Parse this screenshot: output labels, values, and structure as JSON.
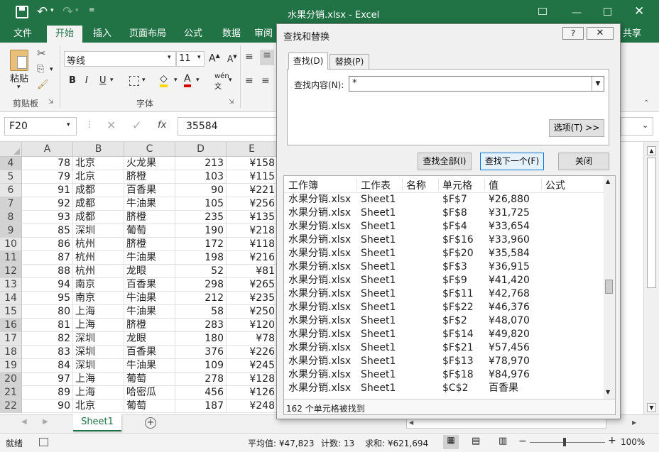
{
  "window": {
    "title": "水果分销.xlsx - Excel"
  },
  "ribbon_tabs": [
    "文件",
    "开始",
    "插入",
    "页面布局",
    "公式",
    "数据",
    "审阅"
  ],
  "ribbon": {
    "paste_label": "粘贴",
    "clipboard_group": "剪贴板",
    "font_group": "字体",
    "font_name": "等线",
    "font_size": "11",
    "share_label": "共享"
  },
  "formula_bar": {
    "name_box": "F20",
    "fx": "fx",
    "value": "35584"
  },
  "grid": {
    "columns": [
      "A",
      "B",
      "C",
      "D",
      "E"
    ],
    "rows": [
      {
        "n": "4",
        "a": "78",
        "b": "北京",
        "c": "火龙果",
        "d": "213",
        "e": "¥158"
      },
      {
        "n": "5",
        "a": "79",
        "b": "北京",
        "c": "脐橙",
        "d": "103",
        "e": "¥115"
      },
      {
        "n": "6",
        "a": "91",
        "b": "成都",
        "c": "百香果",
        "d": "90",
        "e": "¥221"
      },
      {
        "n": "7",
        "a": "92",
        "b": "成都",
        "c": "牛油果",
        "d": "105",
        "e": "¥256"
      },
      {
        "n": "8",
        "a": "93",
        "b": "成都",
        "c": "脐橙",
        "d": "235",
        "e": "¥135"
      },
      {
        "n": "9",
        "a": "85",
        "b": "深圳",
        "c": "葡萄",
        "d": "190",
        "e": "¥218"
      },
      {
        "n": "10",
        "a": "86",
        "b": "杭州",
        "c": "脐橙",
        "d": "172",
        "e": "¥118"
      },
      {
        "n": "11",
        "a": "87",
        "b": "杭州",
        "c": "牛油果",
        "d": "198",
        "e": "¥216"
      },
      {
        "n": "12",
        "a": "88",
        "b": "杭州",
        "c": "龙眼",
        "d": "52",
        "e": "¥81"
      },
      {
        "n": "13",
        "a": "94",
        "b": "南京",
        "c": "百香果",
        "d": "298",
        "e": "¥265"
      },
      {
        "n": "14",
        "a": "95",
        "b": "南京",
        "c": "牛油果",
        "d": "212",
        "e": "¥235"
      },
      {
        "n": "15",
        "a": "80",
        "b": "上海",
        "c": "牛油果",
        "d": "58",
        "e": "¥250"
      },
      {
        "n": "16",
        "a": "81",
        "b": "上海",
        "c": "脐橙",
        "d": "283",
        "e": "¥120"
      },
      {
        "n": "17",
        "a": "82",
        "b": "深圳",
        "c": "龙眼",
        "d": "180",
        "e": "¥78"
      },
      {
        "n": "18",
        "a": "83",
        "b": "深圳",
        "c": "百香果",
        "d": "376",
        "e": "¥226"
      },
      {
        "n": "19",
        "a": "84",
        "b": "深圳",
        "c": "牛油果",
        "d": "109",
        "e": "¥245"
      },
      {
        "n": "20",
        "a": "97",
        "b": "上海",
        "c": "葡萄",
        "d": "278",
        "e": "¥128"
      },
      {
        "n": "21",
        "a": "89",
        "b": "上海",
        "c": "哈密瓜",
        "d": "456",
        "e": "¥126"
      },
      {
        "n": "22",
        "a": "90",
        "b": "北京",
        "c": "葡萄",
        "d": "187",
        "e": "¥248"
      }
    ]
  },
  "sheet_tab": "Sheet1",
  "status": {
    "mode": "就绪",
    "average": "平均值: ¥47,823",
    "count": "计数: 13",
    "sum": "求和: ¥621,694",
    "zoom": "100%"
  },
  "dialog": {
    "title": "查找和替换",
    "help": "?",
    "tab_find": "查找(D)",
    "tab_replace": "替换(P)",
    "find_label": "查找内容(N):",
    "find_value": "*",
    "options_button": "选项(T) >>",
    "find_all_button": "查找全部(I)",
    "find_next_button": "查找下一个(F)",
    "close_button": "关闭",
    "result_headers": [
      "工作簿",
      "工作表",
      "名称",
      "单元格",
      "值",
      "公式"
    ],
    "results": [
      {
        "book": "水果分销.xlsx",
        "sheet": "Sheet1",
        "cell": "$F$7",
        "value": "¥26,880"
      },
      {
        "book": "水果分销.xlsx",
        "sheet": "Sheet1",
        "cell": "$F$8",
        "value": "¥31,725"
      },
      {
        "book": "水果分销.xlsx",
        "sheet": "Sheet1",
        "cell": "$F$4",
        "value": "¥33,654"
      },
      {
        "book": "水果分销.xlsx",
        "sheet": "Sheet1",
        "cell": "$F$16",
        "value": "¥33,960"
      },
      {
        "book": "水果分销.xlsx",
        "sheet": "Sheet1",
        "cell": "$F$20",
        "value": "¥35,584"
      },
      {
        "book": "水果分销.xlsx",
        "sheet": "Sheet1",
        "cell": "$F$3",
        "value": "¥36,915"
      },
      {
        "book": "水果分销.xlsx",
        "sheet": "Sheet1",
        "cell": "$F$9",
        "value": "¥41,420"
      },
      {
        "book": "水果分销.xlsx",
        "sheet": "Sheet1",
        "cell": "$F$11",
        "value": "¥42,768"
      },
      {
        "book": "水果分销.xlsx",
        "sheet": "Sheet1",
        "cell": "$F$22",
        "value": "¥46,376"
      },
      {
        "book": "水果分销.xlsx",
        "sheet": "Sheet1",
        "cell": "$F$2",
        "value": "¥48,070"
      },
      {
        "book": "水果分销.xlsx",
        "sheet": "Sheet1",
        "cell": "$F$14",
        "value": "¥49,820"
      },
      {
        "book": "水果分销.xlsx",
        "sheet": "Sheet1",
        "cell": "$F$21",
        "value": "¥57,456"
      },
      {
        "book": "水果分销.xlsx",
        "sheet": "Sheet1",
        "cell": "$F$13",
        "value": "¥78,970"
      },
      {
        "book": "水果分销.xlsx",
        "sheet": "Sheet1",
        "cell": "$F$18",
        "value": "¥84,976"
      },
      {
        "book": "水果分销.xlsx",
        "sheet": "Sheet1",
        "cell": "$C$2",
        "value": "百香果"
      }
    ],
    "found_status": "162 个单元格被找到"
  },
  "colors": {
    "accent": "#217346",
    "selected_row_header": "#d2d2d2"
  }
}
